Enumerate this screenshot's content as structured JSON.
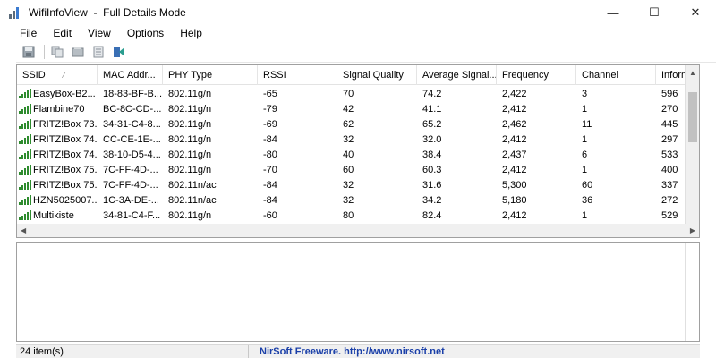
{
  "window": {
    "title": "WifiInfoView  -  Full Details Mode",
    "controls": {
      "minimize": "—",
      "maximize": "☐",
      "close": "✕"
    }
  },
  "menu": [
    "File",
    "Edit",
    "View",
    "Options",
    "Help"
  ],
  "toolbar": {
    "buttons": [
      "save-icon",
      "copy-icon",
      "properties-icon",
      "report-icon",
      "exit-icon"
    ]
  },
  "table": {
    "columns": [
      "SSID",
      "MAC Addr...",
      "PHY Type",
      "RSSI",
      "Signal Quality",
      "Average Signal...",
      "Frequency",
      "Channel",
      "Inform"
    ],
    "sort_column": "SSID",
    "rows": [
      [
        "EasyBox-B2...",
        "18-83-BF-B...",
        "802.11g/n",
        "-65",
        "70",
        "74.2",
        "2,422",
        "3",
        "596"
      ],
      [
        "Flambine70",
        "BC-8C-CD-...",
        "802.11g/n",
        "-79",
        "42",
        "41.1",
        "2,412",
        "1",
        "270"
      ],
      [
        "FRITZ!Box 73...",
        "34-31-C4-8...",
        "802.11g/n",
        "-69",
        "62",
        "65.2",
        "2,462",
        "11",
        "445"
      ],
      [
        "FRITZ!Box 74...",
        "CC-CE-1E-...",
        "802.11g/n",
        "-84",
        "32",
        "32.0",
        "2,412",
        "1",
        "297"
      ],
      [
        "FRITZ!Box 74...",
        "38-10-D5-4...",
        "802.11g/n",
        "-80",
        "40",
        "38.4",
        "2,437",
        "6",
        "533"
      ],
      [
        "FRITZ!Box 75...",
        "7C-FF-4D-...",
        "802.11g/n",
        "-70",
        "60",
        "60.3",
        "2,412",
        "1",
        "400"
      ],
      [
        "FRITZ!Box 75...",
        "7C-FF-4D-...",
        "802.11n/ac",
        "-84",
        "32",
        "31.6",
        "5,300",
        "60",
        "337"
      ],
      [
        "HZN5025007...",
        "1C-3A-DE-...",
        "802.11n/ac",
        "-84",
        "32",
        "34.2",
        "5,180",
        "36",
        "272"
      ],
      [
        "Multikiste",
        "34-81-C4-F...",
        "802.11g/n",
        "-60",
        "80",
        "82.4",
        "2,412",
        "1",
        "529"
      ]
    ]
  },
  "status": {
    "count": "24 item(s)",
    "brand": "NirSoft Freeware.  http://www.nirsoft.net"
  },
  "colors": {
    "signal_icon": "#2e8b2e",
    "brand_link": "#1a3fa8"
  }
}
